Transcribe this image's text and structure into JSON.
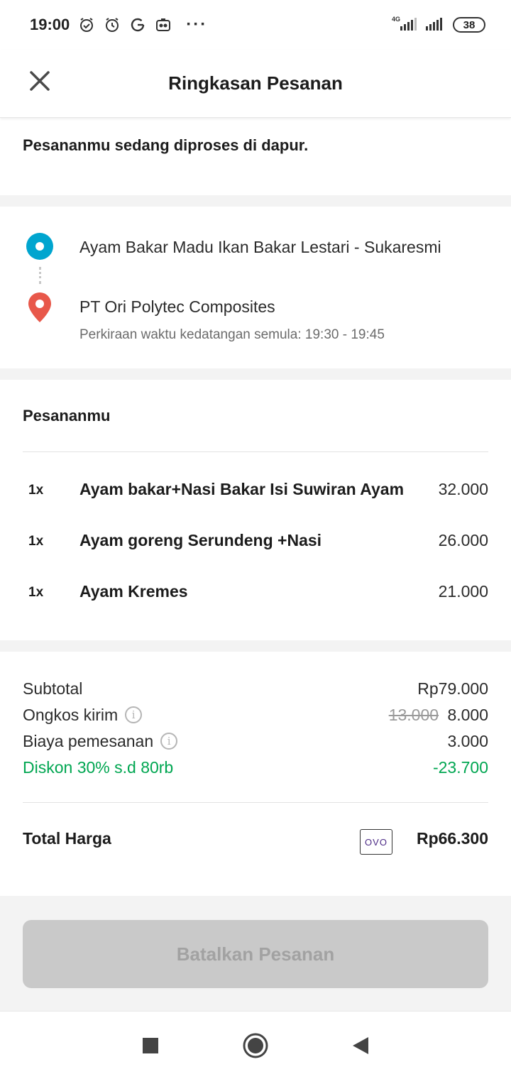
{
  "status_bar": {
    "time": "19:00",
    "network": "4G",
    "battery": "38"
  },
  "header": {
    "title": "Ringkasan Pesanan"
  },
  "order_status": "Pesananmu sedang diproses di dapur.",
  "route": {
    "from": "Ayam Bakar Madu Ikan Bakar Lestari - Sukaresmi",
    "to": "PT Ori Polytec Composites",
    "eta": "Perkiraan waktu kedatangan semula: 19:30 - 19:45"
  },
  "orders": {
    "title": "Pesananmu",
    "items": [
      {
        "qty": "1x",
        "name": "Ayam bakar+Nasi Bakar Isi Suwiran Ayam",
        "price": "32.000"
      },
      {
        "qty": "1x",
        "name": "Ayam goreng Serundeng +Nasi",
        "price": "26.000"
      },
      {
        "qty": "1x",
        "name": "Ayam Kremes",
        "price": "21.000"
      }
    ]
  },
  "summary": {
    "subtotal_label": "Subtotal",
    "subtotal_value": "Rp79.000",
    "delivery_label": "Ongkos kirim",
    "delivery_original": "13.000",
    "delivery_value": "8.000",
    "order_fee_label": "Biaya pemesanan",
    "order_fee_value": "3.000",
    "discount_label": "Diskon 30% s.d 80rb",
    "discount_value": "-23.700",
    "total_label": "Total Harga",
    "payment_method": "OVO",
    "total_value": "Rp66.300"
  },
  "cancel_button": "Batalkan Pesanan",
  "colors": {
    "accent_blue": "#00a5cf",
    "pin_red": "#e8584a",
    "discount_green": "#00a651"
  },
  "icons": {
    "close": "close-icon",
    "origin": "origin-dot-icon",
    "destination": "location-pin-icon",
    "info": "info-icon",
    "nav_recent": "square-icon",
    "nav_home": "circle-icon",
    "nav_back": "triangle-back-icon"
  }
}
